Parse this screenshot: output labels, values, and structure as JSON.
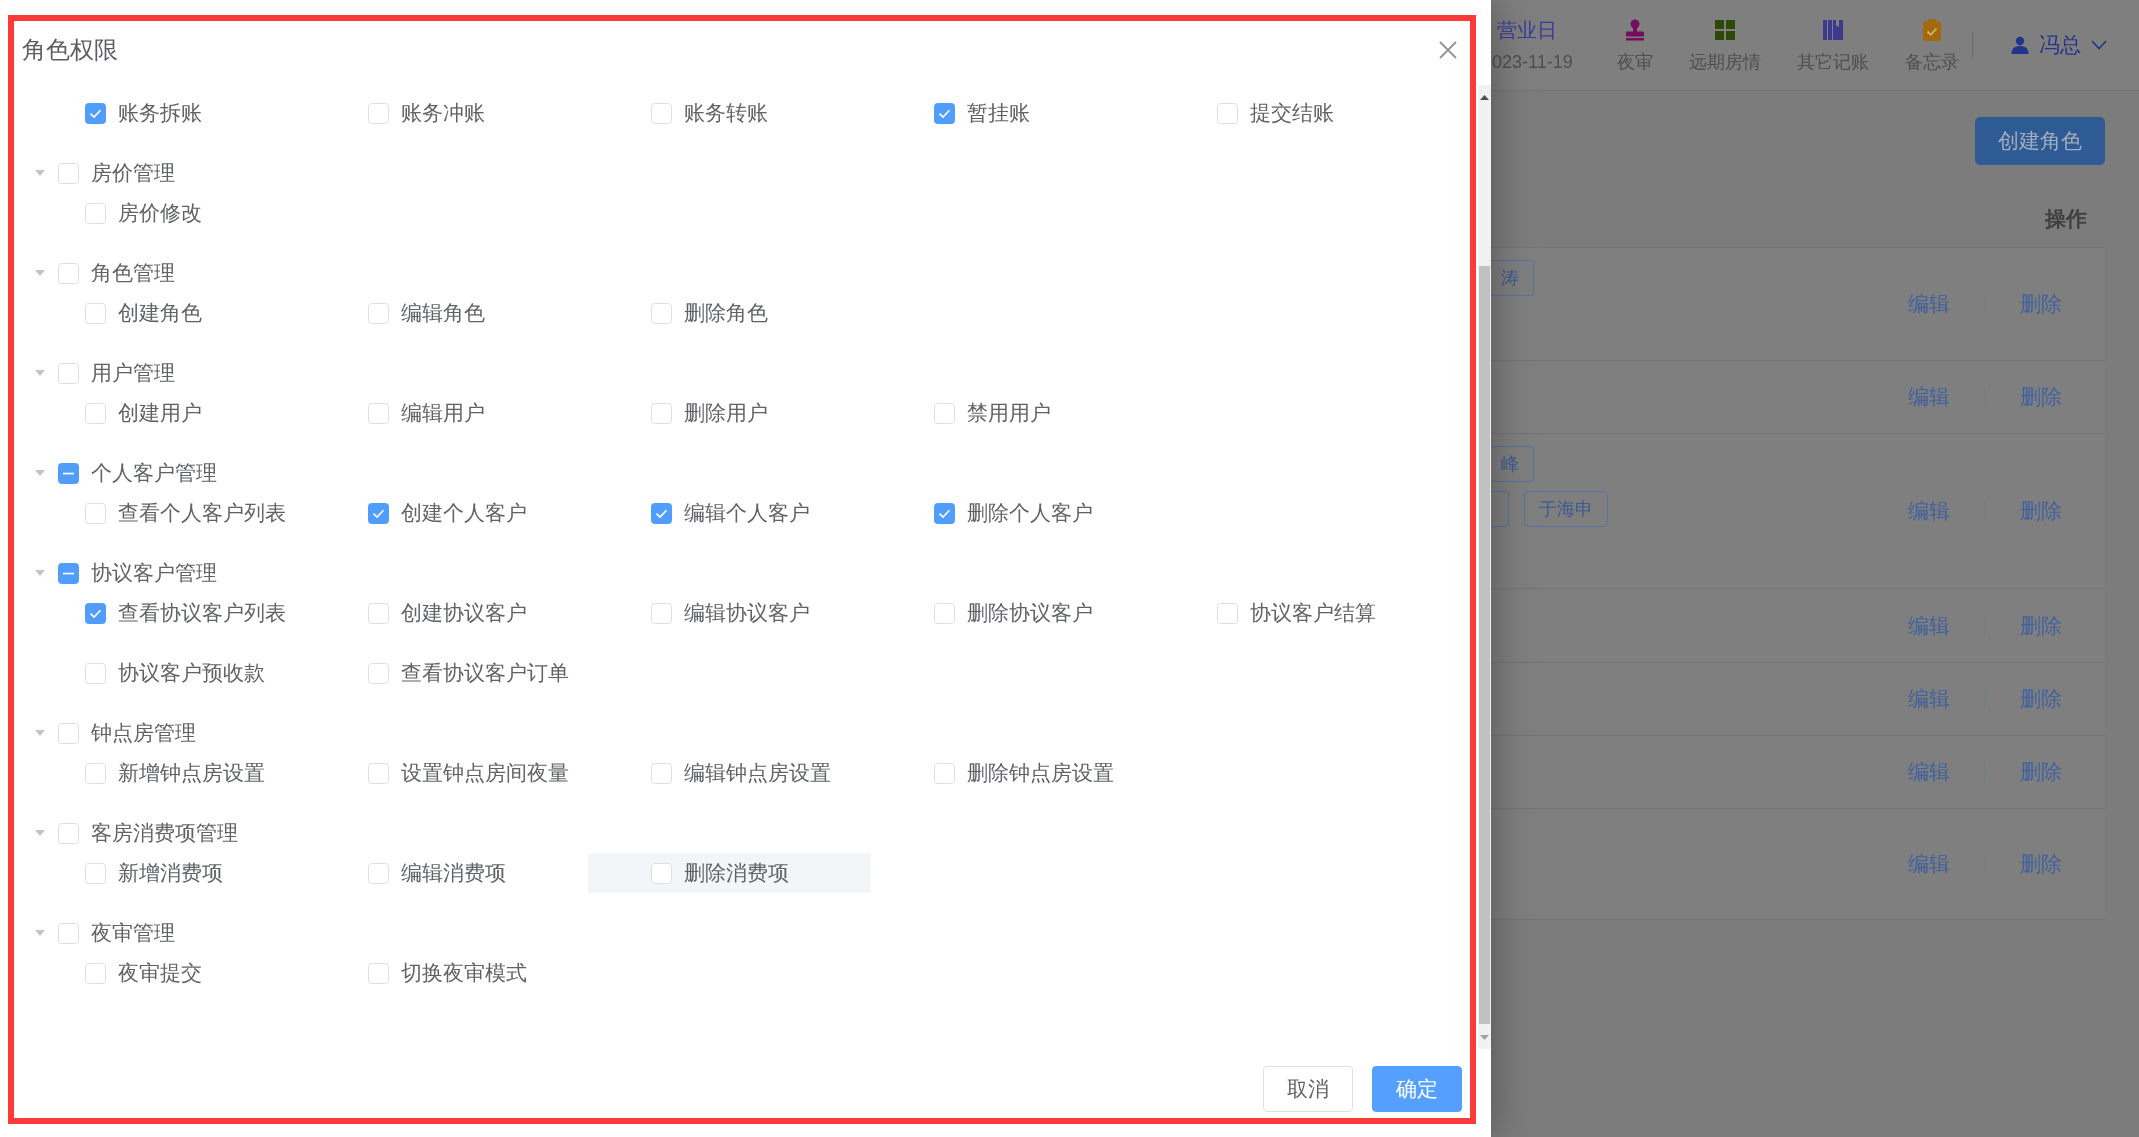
{
  "dialog": {
    "title": "角色权限",
    "groups": [
      {
        "items": [
          {
            "label": "账务拆账",
            "checked": true,
            "hovered": false
          },
          {
            "label": "账务冲账",
            "checked": false,
            "hovered": false
          },
          {
            "label": "账务转账",
            "checked": false,
            "hovered": false
          },
          {
            "label": "暂挂账",
            "checked": true,
            "hovered": false
          },
          {
            "label": "提交结账",
            "checked": false,
            "hovered": false
          }
        ]
      },
      {
        "label": "房价管理",
        "expanded": true,
        "checked": false,
        "indeterminate": false,
        "items": [
          {
            "label": "房价修改",
            "checked": false,
            "hovered": false
          }
        ]
      },
      {
        "label": "角色管理",
        "expanded": true,
        "checked": false,
        "indeterminate": false,
        "items": [
          {
            "label": "创建角色",
            "checked": false,
            "hovered": false
          },
          {
            "label": "编辑角色",
            "checked": false,
            "hovered": false
          },
          {
            "label": "删除角色",
            "checked": false,
            "hovered": false
          }
        ]
      },
      {
        "label": "用户管理",
        "expanded": true,
        "checked": false,
        "indeterminate": false,
        "items": [
          {
            "label": "创建用户",
            "checked": false,
            "hovered": false
          },
          {
            "label": "编辑用户",
            "checked": false,
            "hovered": false
          },
          {
            "label": "删除用户",
            "checked": false,
            "hovered": false
          },
          {
            "label": "禁用用户",
            "checked": false,
            "hovered": false
          }
        ]
      },
      {
        "label": "个人客户管理",
        "expanded": true,
        "checked": false,
        "indeterminate": true,
        "items": [
          {
            "label": "查看个人客户列表",
            "checked": false,
            "hovered": false
          },
          {
            "label": "创建个人客户",
            "checked": true,
            "hovered": false
          },
          {
            "label": "编辑个人客户",
            "checked": true,
            "hovered": false
          },
          {
            "label": "删除个人客户",
            "checked": true,
            "hovered": false
          }
        ]
      },
      {
        "label": "协议客户管理",
        "expanded": true,
        "checked": false,
        "indeterminate": true,
        "items": [
          {
            "label": "查看协议客户列表",
            "checked": true,
            "hovered": false
          },
          {
            "label": "创建协议客户",
            "checked": false,
            "hovered": false
          },
          {
            "label": "编辑协议客户",
            "checked": false,
            "hovered": false
          },
          {
            "label": "删除协议客户",
            "checked": false,
            "hovered": false
          },
          {
            "label": "协议客户结算",
            "checked": false,
            "hovered": false
          },
          {
            "label": "协议客户预收款",
            "checked": false,
            "hovered": false
          },
          {
            "label": "查看协议客户订单",
            "checked": false,
            "hovered": false
          }
        ]
      },
      {
        "label": "钟点房管理",
        "expanded": true,
        "checked": false,
        "indeterminate": false,
        "items": [
          {
            "label": "新增钟点房设置",
            "checked": false,
            "hovered": false
          },
          {
            "label": "设置钟点房间夜量",
            "checked": false,
            "hovered": false
          },
          {
            "label": "编辑钟点房设置",
            "checked": false,
            "hovered": false
          },
          {
            "label": "删除钟点房设置",
            "checked": false,
            "hovered": false
          }
        ]
      },
      {
        "label": "客房消费项管理",
        "expanded": true,
        "checked": false,
        "indeterminate": false,
        "items": [
          {
            "label": "新增消费项",
            "checked": false,
            "hovered": false
          },
          {
            "label": "编辑消费项",
            "checked": false,
            "hovered": false
          },
          {
            "label": "删除消费项",
            "checked": false,
            "hovered": true
          }
        ]
      },
      {
        "label": "夜审管理",
        "expanded": true,
        "checked": false,
        "indeterminate": false,
        "items": [
          {
            "label": "夜审提交",
            "checked": false,
            "hovered": false
          },
          {
            "label": "切换夜审模式",
            "checked": false,
            "hovered": false
          }
        ]
      }
    ],
    "buttons": [
      {
        "label": "取消",
        "kind": "plain"
      },
      {
        "label": "确定",
        "kind": "primary"
      }
    ]
  },
  "page": {
    "header": {
      "business_day": {
        "label": "营业日",
        "date": "023-11-19"
      },
      "nav": [
        {
          "label": "夜审"
        },
        {
          "label": "远期房情"
        },
        {
          "label": "其它记账"
        },
        {
          "label": "备忘录"
        }
      ],
      "user": {
        "name": "冯总"
      }
    },
    "create_button": {
      "label": "创建角色"
    },
    "table": {
      "columns": [
        {
          "label": "操作"
        }
      ],
      "rows": [
        {
          "tag_lines": [
            [
              {
                "kind": "cut",
                "text": "涛"
              }
            ]
          ],
          "actions": [
            "编辑",
            "删除"
          ]
        },
        {
          "actions": [
            "编辑",
            "删除"
          ]
        },
        {
          "tag_lines": [
            [
              {
                "kind": "cut",
                "text": "峰"
              }
            ],
            [
              {
                "kind": "cut"
              },
              {
                "kind": "full",
                "text": "于海申"
              }
            ]
          ],
          "actions": [
            "编辑",
            "删除"
          ]
        },
        {
          "actions": [
            "编辑",
            "删除"
          ]
        },
        {
          "actions": [
            "编辑",
            "删除"
          ]
        },
        {
          "actions": [
            "编辑",
            "删除"
          ]
        },
        {
          "actions": [
            "编辑",
            "删除"
          ]
        }
      ]
    }
  }
}
